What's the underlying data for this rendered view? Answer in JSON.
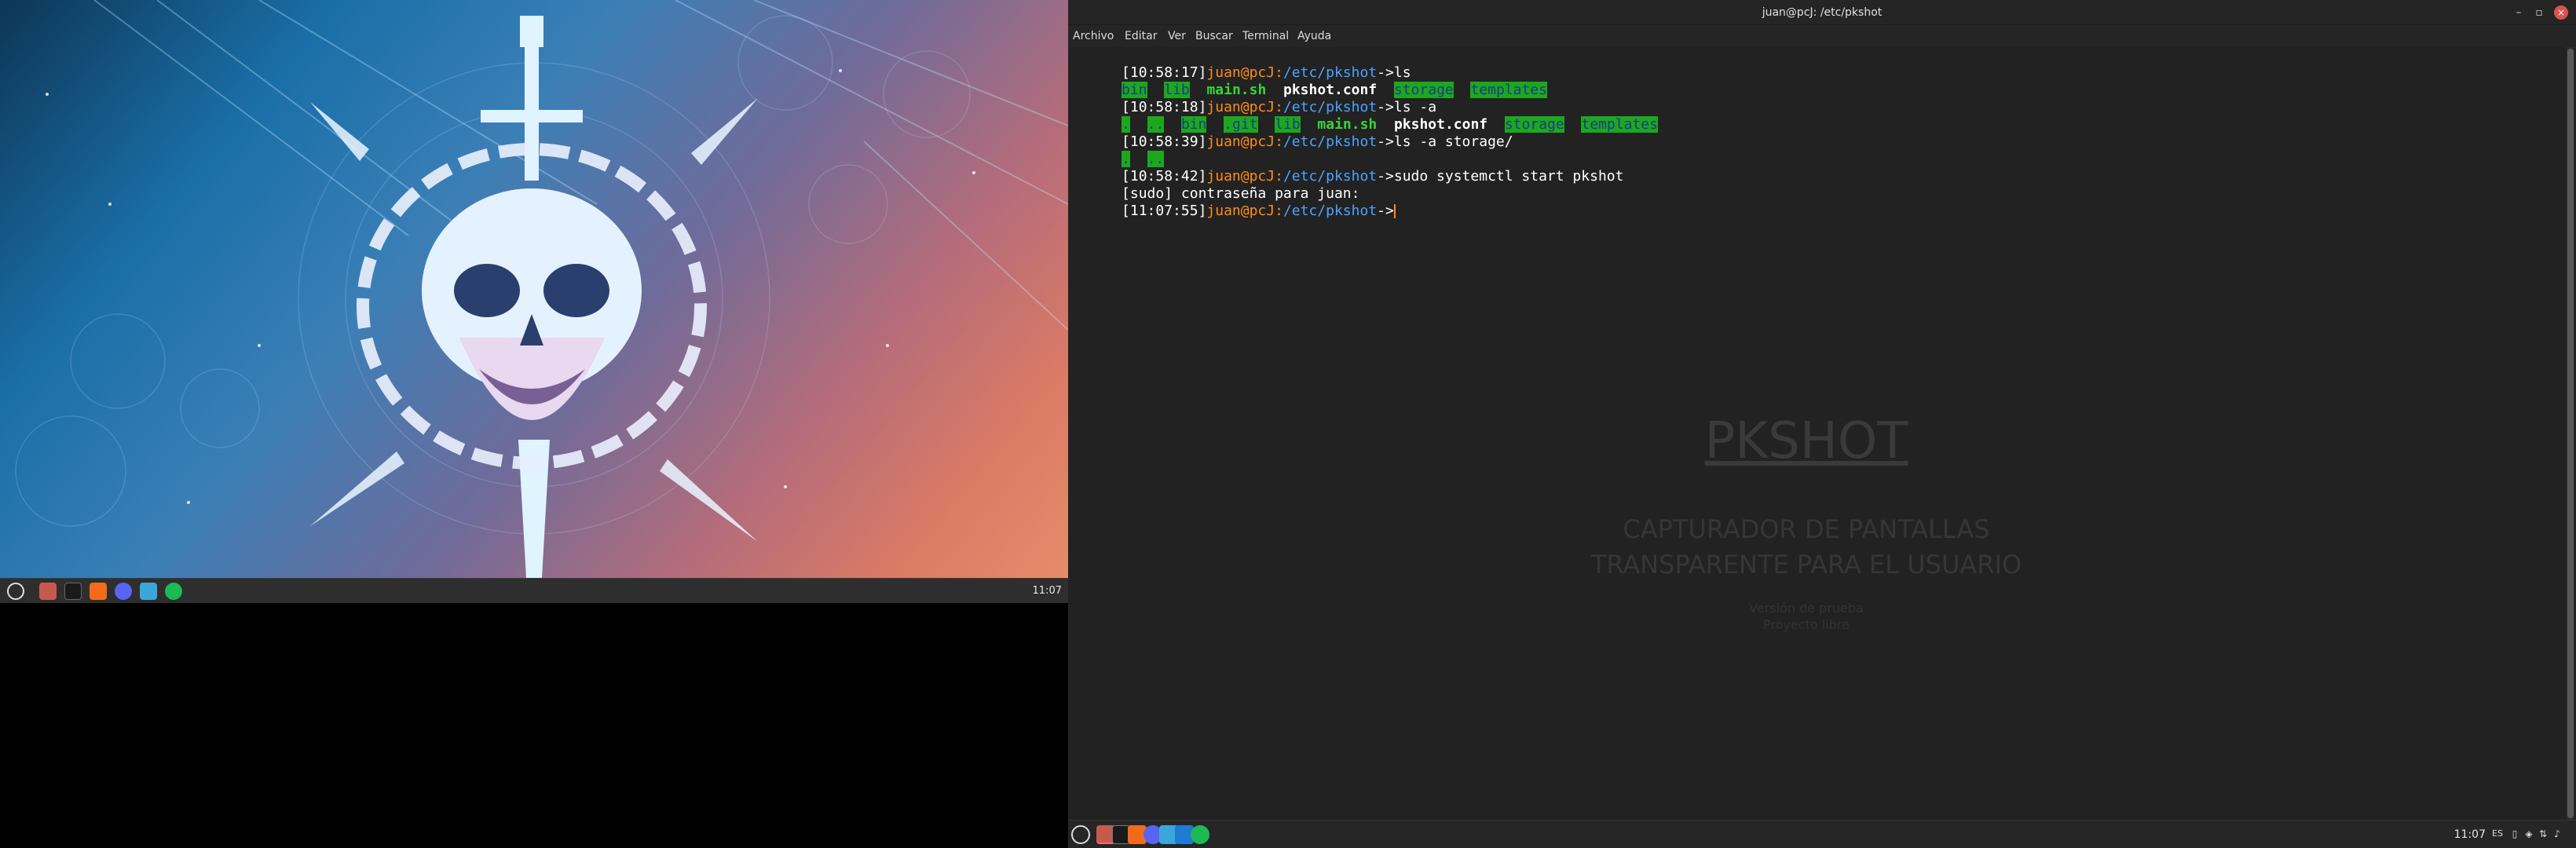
{
  "left": {
    "clock": "11:07",
    "taskbar_icons": [
      "mint-menu-icon",
      "files-icon",
      "terminal-icon",
      "brave-icon",
      "discord-icon",
      "photo-editor-icon",
      "spotify-icon"
    ]
  },
  "window": {
    "title": "juan@pcJ: /etc/pkshot",
    "minimize": "–",
    "maximize": "▫",
    "close": "×"
  },
  "menu": [
    "Archivo",
    "Editar",
    "Ver",
    "Buscar",
    "Terminal",
    "Ayuda"
  ],
  "terminal": {
    "lines": [
      {
        "ts": "[10:58:17]",
        "user": "juan@pcJ:",
        "path": "/etc/pkshot",
        "arrow": "->",
        "cmd": "ls"
      },
      {
        "out1": "bin",
        "out2": "lib",
        "out3": "main.sh",
        "out4": "pkshot.conf",
        "out5": "storage",
        "out6": "templates"
      },
      {
        "ts": "[10:58:18]",
        "user": "juan@pcJ:",
        "path": "/etc/pkshot",
        "arrow": "->",
        "cmd": "ls -a"
      },
      {
        "o1": ".",
        "o2": "..",
        "o3": "bin",
        "o4": ".git",
        "o5": "lib",
        "o6": "main.sh",
        "o7": "pkshot.conf",
        "o8": "storage",
        "o9": "templates"
      },
      {
        "ts": "[10:58:39]",
        "user": "juan@pcJ:",
        "path": "/etc/pkshot",
        "arrow": "->",
        "cmd": "ls -a storage/"
      },
      {
        "o1": ".",
        "o2": ".."
      },
      {
        "ts": "[10:58:42]",
        "user": "juan@pcJ:",
        "path": "/etc/pkshot",
        "arrow": "->",
        "cmd": "sudo systemctl start pkshot"
      },
      {
        "text": "[sudo] contraseña para juan:"
      },
      {
        "ts": "[11:07:55]",
        "user": "juan@pcJ:",
        "path": "/etc/pkshot",
        "arrow": "->",
        "cmd": ""
      }
    ]
  },
  "ghost": {
    "title": "PKSHOT",
    "sub1": "CAPTURADOR DE PANTALLAS",
    "sub2": "TRANSPARENTE PARA EL USUARIO",
    "small1": "Versión de prueba",
    "small2": "Proyecto libre"
  },
  "right_panel": {
    "clock": "11:07",
    "layout": "ES",
    "apps": [
      "mint-menu-icon",
      "files-icon",
      "terminal-icon",
      "brave-icon",
      "discord-icon",
      "photo-editor-icon",
      "vscode-icon",
      "spotify-icon"
    ]
  },
  "colors": {
    "prompt_user": "#ff8c1a",
    "prompt_path": "#4aa3ff",
    "dir_highlight": "#1ca81c",
    "terminal_bg": "#232323"
  }
}
